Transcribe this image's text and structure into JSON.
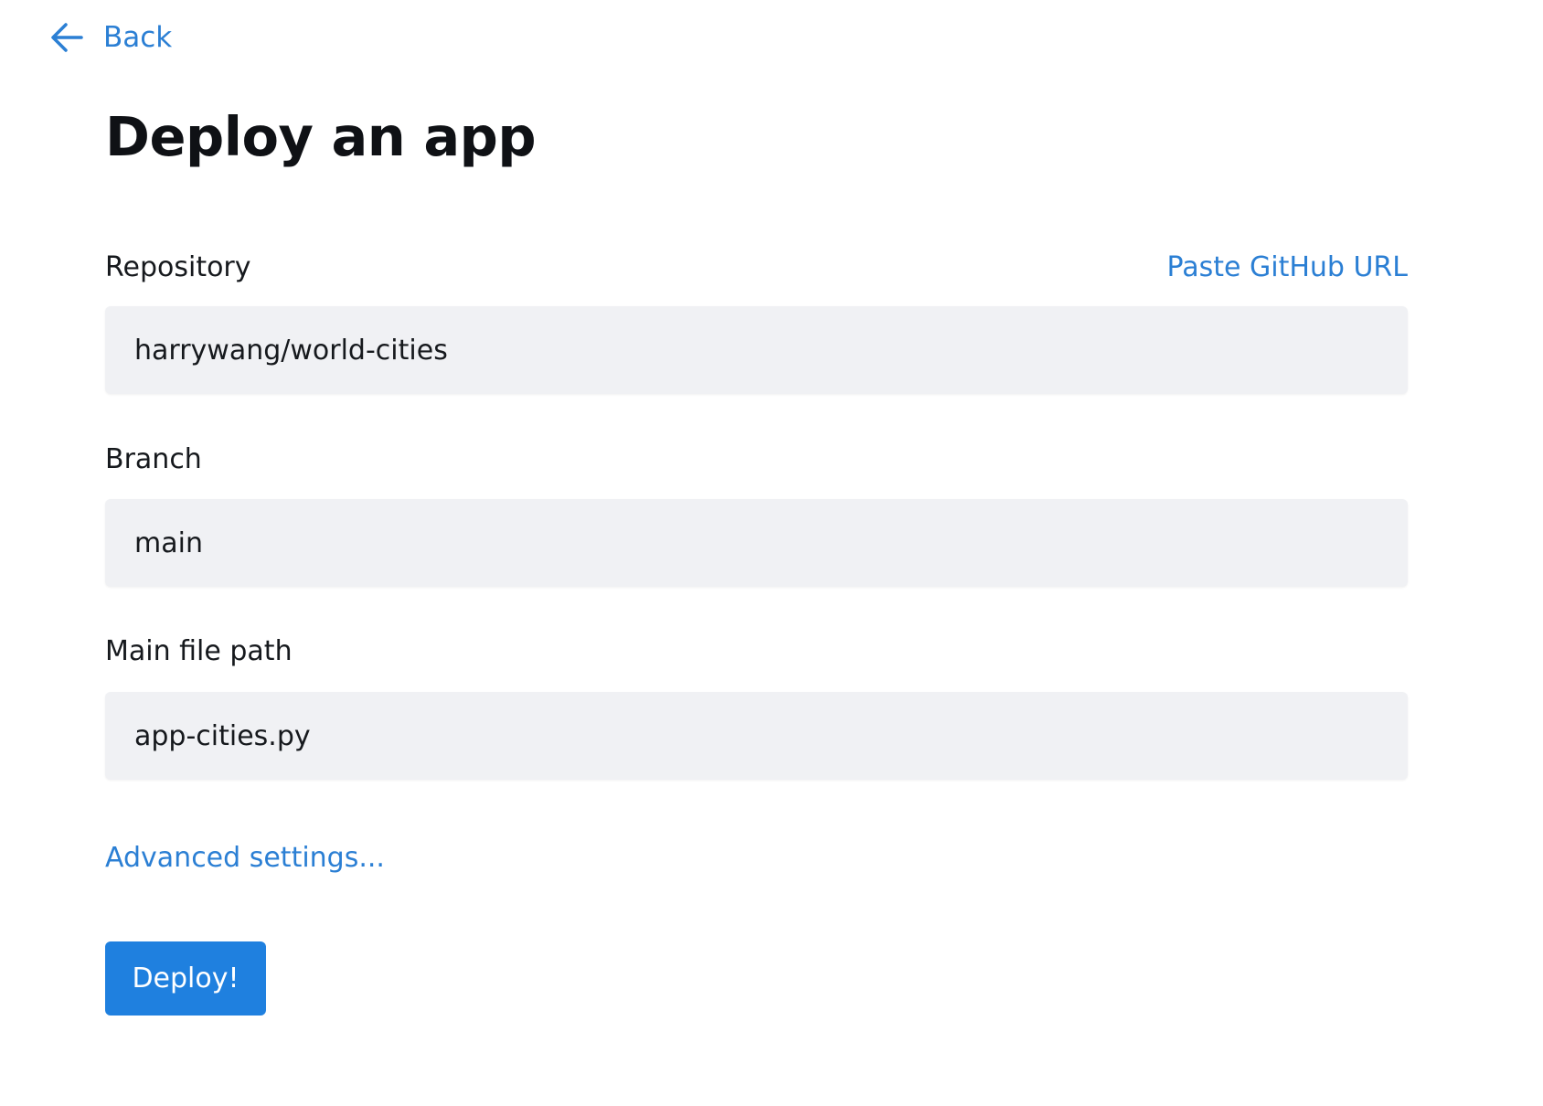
{
  "nav": {
    "back_label": "Back",
    "back_icon": "arrow-left-icon"
  },
  "page": {
    "title": "Deploy an app"
  },
  "form": {
    "repository": {
      "label": "Repository",
      "value": "harrywang/world-cities",
      "paste_link": "Paste GitHub URL"
    },
    "branch": {
      "label": "Branch",
      "value": "main"
    },
    "main_file": {
      "label": "Main file path",
      "value": "app-cities.py"
    },
    "advanced_link": "Advanced settings...",
    "submit_label": "Deploy!"
  },
  "colors": {
    "accent": "#2b7fd4",
    "button": "#1f80df",
    "field_background": "#f0f1f4",
    "text": "#16191d"
  }
}
